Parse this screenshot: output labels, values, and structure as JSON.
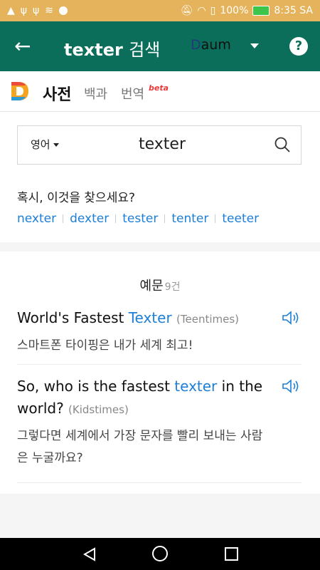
{
  "status_bar": {
    "battery": "100%",
    "time": "8:35 SA",
    "icons": [
      "gallery-icon",
      "usb-icon",
      "usb-icon",
      "signal-icon",
      "dot-icon",
      "mute-icon",
      "wifi-icon",
      "sim-icon",
      "battery-icon"
    ]
  },
  "app_bar": {
    "query_term": "texter",
    "search_label": "검색",
    "provider_d": "D",
    "provider_rest": "aum",
    "help_symbol": "?",
    "back_symbol": "←"
  },
  "dict_tabs": {
    "main": "사전",
    "encyclopedia": "백과",
    "translate": "번역",
    "beta": "beta"
  },
  "search": {
    "language": "영어",
    "query": "texter"
  },
  "suggestions": {
    "title": "혹시, 이것을 찾으세요?",
    "items": [
      "nexter",
      "dexter",
      "tester",
      "tenter",
      "teeter"
    ]
  },
  "examples": {
    "label": "예문",
    "count": "9건",
    "items": [
      {
        "en_before": "World's Fastest ",
        "en_highlight": "Texter",
        "en_after": "",
        "source": "(Teentimes)",
        "ko": "스마트폰 타이핑은 내가 세계 최고!"
      },
      {
        "en_before": "So, who is the fastest ",
        "en_highlight": "texter",
        "en_after": " in the world?",
        "source": "(Kidstimes)",
        "ko": "그렇다면 세계에서 가장 문자를 빨리 보내는 사람은 누굴까요?"
      }
    ]
  },
  "colors": {
    "status_bar": "#e4b35c",
    "app_bar": "#0b6e5a",
    "link": "#1d7fd6",
    "highlight": "#f7ea2a"
  }
}
